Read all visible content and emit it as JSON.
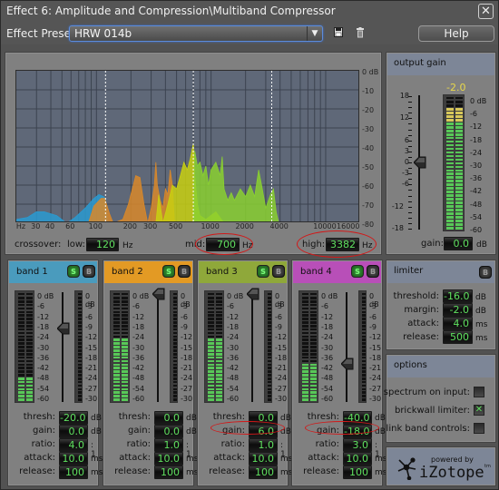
{
  "window": {
    "title": "Effect 6: Amplitude and Compression\\Multiband Compressor",
    "close_icon": "close-x"
  },
  "preset": {
    "label": "Effect Preset:",
    "value": "HRW 014b",
    "save_icon": "floppy-disk",
    "delete_icon": "trash-can",
    "help_label": "Help"
  },
  "spectrum": {
    "y_labels": [
      "0 dB",
      "-10",
      "-20",
      "-30",
      "-40",
      "-50",
      "-60",
      "-70",
      "-80"
    ],
    "x_labels": [
      "Hz",
      "30",
      "40",
      "60",
      "100",
      "200",
      "300",
      "500",
      "1000",
      "2000",
      "4000",
      "10000",
      "16000"
    ],
    "crossover_label": "crossover:",
    "low_label": "low:",
    "low_value": "120",
    "mid_label": "mid:",
    "mid_value": "700",
    "high_label": "high:",
    "high_value": "3382",
    "unit": "Hz",
    "band_colors": [
      "#2a9ad0",
      "#d8882a",
      "#c8d010",
      "#8ad030"
    ]
  },
  "output_gain": {
    "title": "output gain",
    "peak": "-2.0",
    "fader_scale": [
      "18",
      "12",
      "6",
      "3",
      "0",
      "-3",
      "-6",
      "-12",
      "-18"
    ],
    "meter_scale": [
      "0 dB",
      "-6",
      "-12",
      "-18",
      "-24",
      "-30",
      "-36",
      "-42",
      "-48",
      "-54",
      "-60"
    ],
    "gain_label": "gain:",
    "gain_value": "0.0",
    "gain_unit": "dB",
    "fader_db": 0,
    "meter_level_db": -2
  },
  "bands": [
    {
      "name": "band 1",
      "color": "#4a9bbd",
      "solo_label": "S",
      "bypass_label": "B",
      "meter_level_db": -47,
      "fader_db": -20,
      "gr_db": 0,
      "thresh": "-20.0",
      "gain": "0.0",
      "ratio": "4.0",
      "attack": "10.0",
      "release": "100"
    },
    {
      "name": "band 2",
      "color": "#e39a24",
      "solo_label": "S",
      "bypass_label": "B",
      "meter_level_db": -23,
      "fader_db": 0,
      "gr_db": 0,
      "thresh": "0.0",
      "gain": "0.0",
      "ratio": "1.0",
      "attack": "10.0",
      "release": "100"
    },
    {
      "name": "band 3",
      "color": "#8fa83a",
      "solo_label": "S",
      "bypass_label": "B",
      "meter_level_db": -23,
      "fader_db": 0,
      "gr_db": 0,
      "thresh": "0.0",
      "gain": "6.0",
      "ratio": "1.0",
      "attack": "10.0",
      "release": "100"
    },
    {
      "name": "band 4",
      "color": "#b84fb8",
      "solo_label": "S",
      "bypass_label": "B",
      "meter_level_db": -39,
      "fader_db": -40,
      "gr_db": 0,
      "thresh": "-40.0",
      "gain": "-18.0",
      "ratio": "3.0",
      "attack": "10.0",
      "release": "100"
    }
  ],
  "band_labels": {
    "thresh": "thresh:",
    "gain": "gain:",
    "ratio": "ratio:",
    "attack": "attack:",
    "release": "release:",
    "db": "dB",
    "ratio_unit": ": 1",
    "ms": "ms",
    "meter_scale": [
      "0 dB",
      "-6",
      "-12",
      "-18",
      "-24",
      "-30",
      "-36",
      "-42",
      "-48",
      "-54",
      "-60"
    ],
    "gr_scale": [
      "0 dB",
      "-3",
      "-6",
      "-9",
      "-12",
      "-15",
      "-18",
      "-21",
      "-24",
      "-27",
      "-30"
    ]
  },
  "limiter": {
    "title": "limiter",
    "bypass_label": "B",
    "threshold_label": "threshold:",
    "threshold": "-16.0",
    "threshold_unit": "dB",
    "margin_label": "margin:",
    "margin": "-2.0",
    "margin_unit": "dB",
    "attack_label": "attack:",
    "attack": "4.0",
    "attack_unit": "ms",
    "release_label": "release:",
    "release": "500",
    "release_unit": "ms"
  },
  "options": {
    "title": "options",
    "items": [
      {
        "label": "spectrum on input:",
        "checked": false
      },
      {
        "label": "brickwall limiter:",
        "checked": true
      },
      {
        "label": "link band controls:",
        "checked": false
      }
    ]
  },
  "logo": {
    "powered_by": "powered by",
    "brand": "iZotope",
    "tm": "tm"
  }
}
